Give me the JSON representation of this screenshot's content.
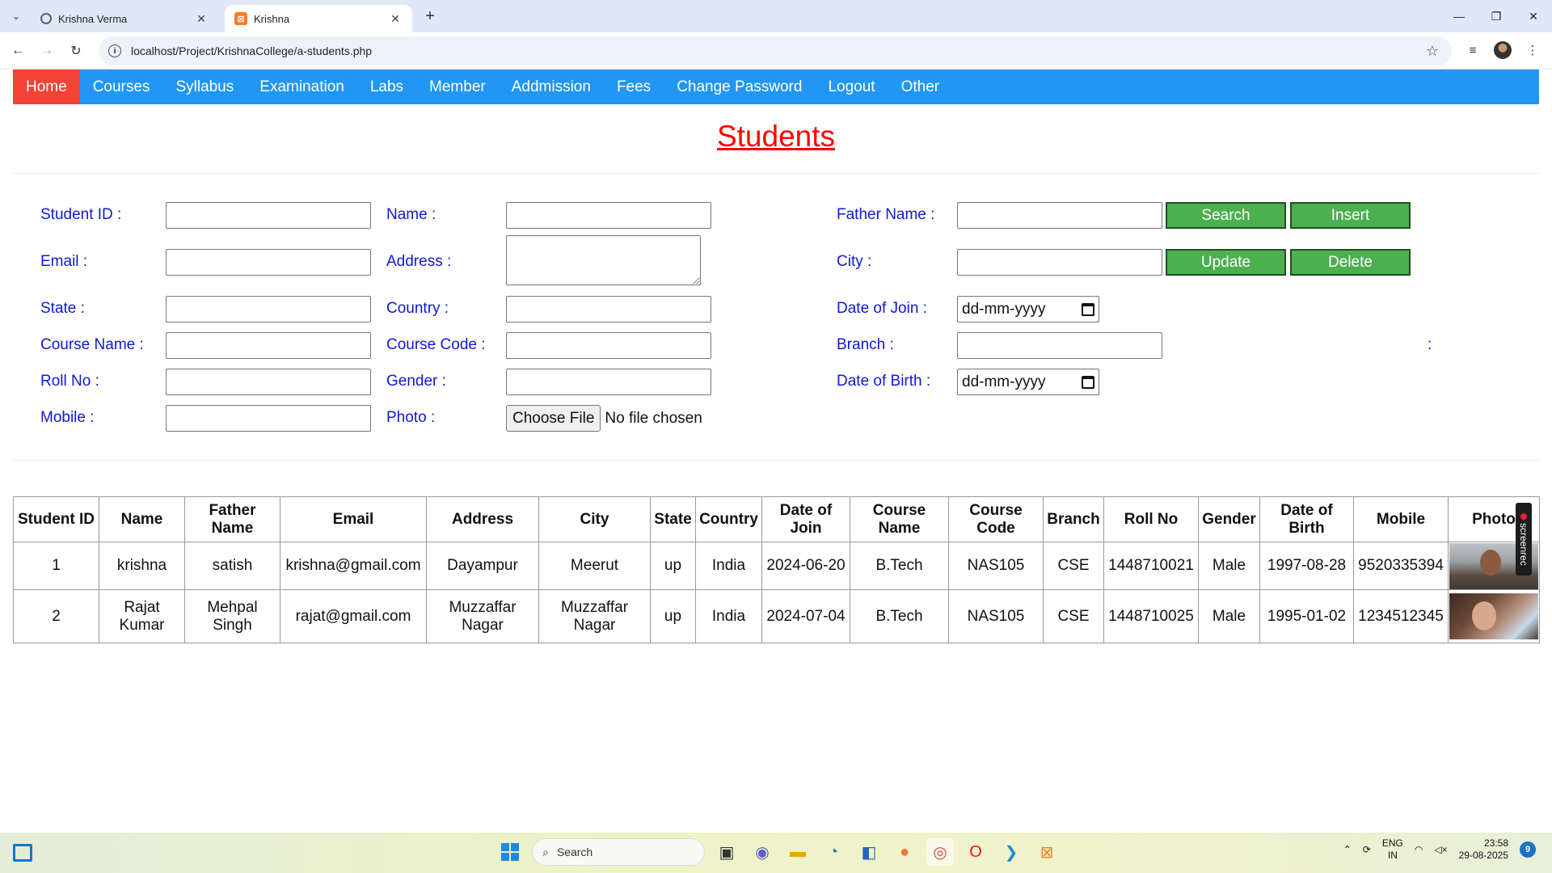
{
  "browser": {
    "tabs": [
      {
        "title": "Krishna Verma",
        "icon": "globe-icon"
      },
      {
        "title": "Krishna",
        "icon": "xampp-icon"
      }
    ],
    "url": "localhost/Project/KrishnaCollege/a-students.php"
  },
  "nav": {
    "items": [
      "Home",
      "Courses",
      "Syllabus",
      "Examination",
      "Labs",
      "Member",
      "Addmission",
      "Fees",
      "Change Password",
      "Logout",
      "Other"
    ],
    "active_index": 0,
    "bg_color": "#2196f3",
    "active_color": "#f44336"
  },
  "page": {
    "title": "Students"
  },
  "form": {
    "student_id_label": "Student ID :",
    "name_label": "Name :",
    "father_name_label": "Father Name :",
    "email_label": "Email :",
    "address_label": "Address :",
    "city_label": "City :",
    "state_label": "State :",
    "country_label": "Country :",
    "date_of_join_label": "Date of Join :",
    "course_name_label": "Course Name :",
    "course_code_label": "Course Code :",
    "branch_label": "Branch :",
    "roll_no_label": "Roll No :",
    "gender_label": "Gender :",
    "date_of_birth_label": "Date of Birth :",
    "mobile_label": "Mobile :",
    "photo_label": "Photo :",
    "stray_colon": ":",
    "date_placeholder": "dd-mm-yyyy",
    "file_button": "Choose File",
    "file_status": "No file chosen",
    "buttons": {
      "search": "Search",
      "insert": "Insert",
      "update": "Update",
      "delete": "Delete"
    },
    "button_color": "#4caf50"
  },
  "table": {
    "headers": [
      "Student ID",
      "Name",
      "Father Name",
      "Email",
      "Address",
      "City",
      "State",
      "Country",
      "Date of Join",
      "Course Name",
      "Course Code",
      "Branch",
      "Roll No",
      "Gender",
      "Date of Birth",
      "Mobile",
      "Photo"
    ],
    "rows": [
      [
        "1",
        "krishna",
        "satish",
        "krishna@gmail.com",
        "Dayampur",
        "Meerut",
        "up",
        "India",
        "2024-06-20",
        "B.Tech",
        "NAS105",
        "CSE",
        "1448710021",
        "Male",
        "1997-08-28",
        "9520335394"
      ],
      [
        "2",
        "Rajat Kumar",
        "Mehpal Singh",
        "rajat@gmail.com",
        "Muzzaffar Nagar",
        "Muzzaffar Nagar",
        "up",
        "India",
        "2024-07-04",
        "B.Tech",
        "NAS105",
        "CSE",
        "1448710025",
        "Male",
        "1995-01-02",
        "1234512345"
      ]
    ]
  },
  "overlay": {
    "screenrec": "screenrec"
  },
  "taskbar": {
    "search_placeholder": "Search",
    "lang": "ENG",
    "region": "IN",
    "time": "23:58",
    "date": "29-08-2025",
    "notifications": "9"
  }
}
